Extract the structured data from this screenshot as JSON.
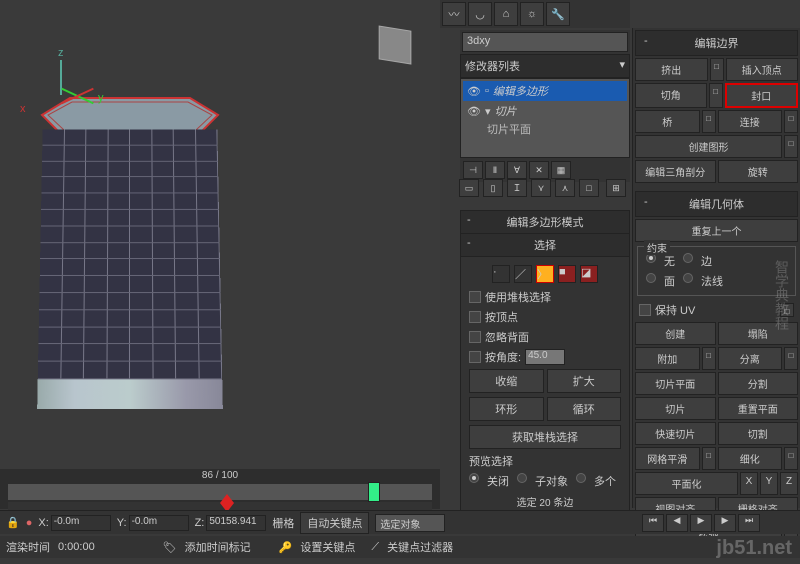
{
  "scene_name": "3dxy",
  "modifier_list_label": "修改器列表",
  "modifiers": {
    "items": [
      {
        "label": "编辑多边形",
        "selected": true
      },
      {
        "label": "切片",
        "selected": false
      }
    ],
    "sub_item": "切片平面"
  },
  "edit_border": {
    "title": "编辑边界",
    "rows": [
      {
        "a": "挤出",
        "b": "插入顶点"
      },
      {
        "a": "切角",
        "b": "封口",
        "highlight_b": true
      },
      {
        "a": "桥",
        "b": "连接"
      }
    ],
    "create_shape": "创建图形",
    "edit_tri": "编辑三角剖分",
    "spin": "旋转"
  },
  "edit_geom": {
    "title": "编辑几何体",
    "repeat_last": "重复上一个",
    "constraint_label": "约束",
    "none": "无",
    "edge": "边",
    "face": "面",
    "normal": "法线",
    "preserve_uv": "保持 UV",
    "create": "创建",
    "collapse": "塌陷",
    "attach": "附加",
    "detach": "分离",
    "slice_plane": "切片平面",
    "split": "分割",
    "slice": "切片",
    "reset_plane": "重置平面",
    "quick_slice": "快速切片",
    "cut": "切割",
    "msmooth": "网格平滑",
    "tessellate": "细化",
    "make_planar": "平面化",
    "x": "X",
    "y": "Y",
    "z": "Z",
    "view_align": "视图对齐",
    "grid_align": "栅格对齐",
    "relax": "松弛"
  },
  "poly_mode": {
    "title": "编辑多边形模式",
    "select_title": "选择",
    "use_stack": "使用堆栈选择",
    "by_vertex": "按顶点",
    "ignore_back": "忽略背面",
    "by_angle": "按角度:",
    "angle_val": "45.0",
    "shrink": "收缩",
    "grow": "扩大",
    "ring": "环形",
    "loop": "循环",
    "get_stack": "获取堆栈选择",
    "preview_sel": "预览选择",
    "off": "关闭",
    "subobj": "子对象",
    "multi": "多个",
    "sel_info": "选定 20 条边"
  },
  "timeline": {
    "frame_label": "86 / 100",
    "x_label": "X:",
    "x_val": "-0.0m",
    "y_label": "Y:",
    "y_val": "-0.0m",
    "z_label": "Z:",
    "z_val": "50158.941",
    "grid_label": "栅格",
    "auto_key": "自动关键点",
    "sel_filter": "选定对象",
    "set_key": "设置关键点",
    "key_filter": "关键点过滤器",
    "render_time_label": "渲染时间",
    "render_time": "0:00:00",
    "add_marker": "添加时间标记"
  },
  "axis_labels": {
    "x": "x",
    "y": "y",
    "z": "z"
  }
}
